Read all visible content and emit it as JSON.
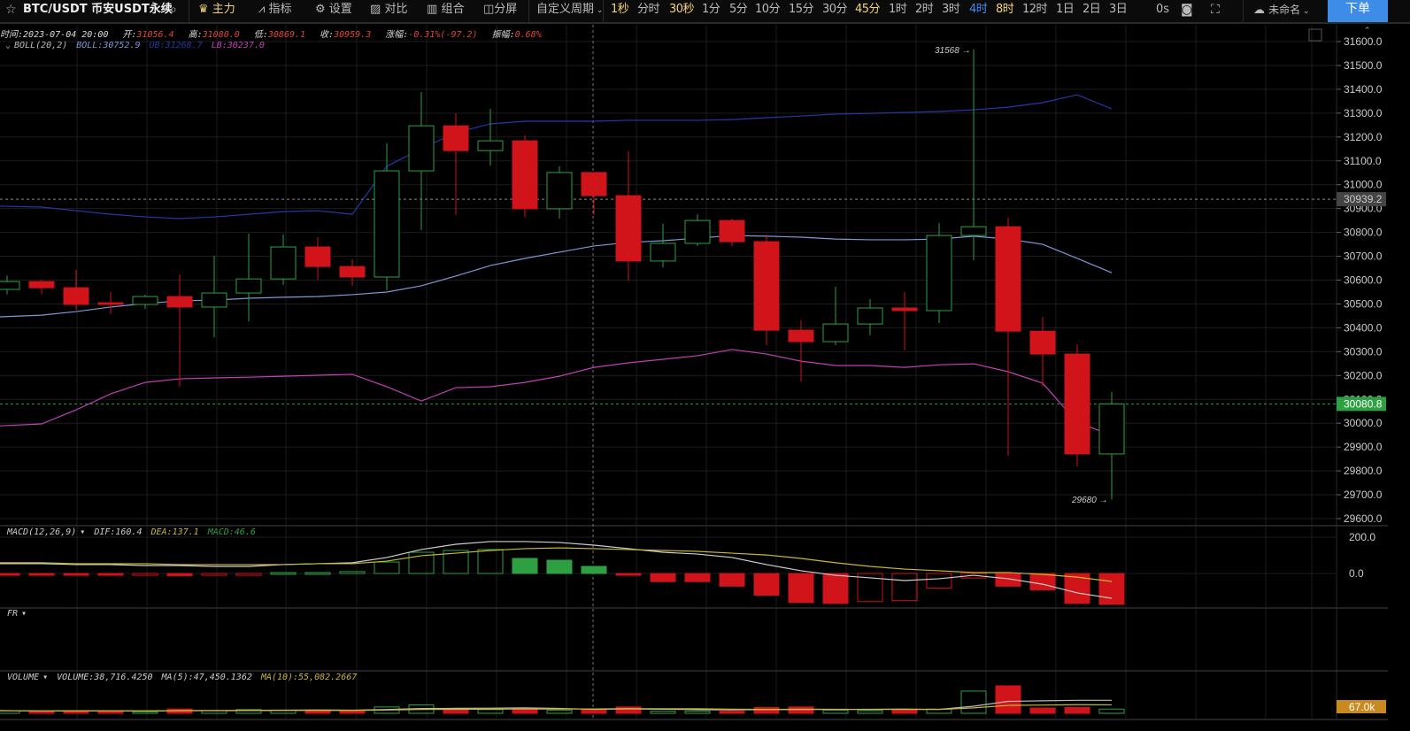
{
  "toolbar": {
    "symbol": "BTC/USDT 币安USDT永续",
    "main": "主力",
    "indicators": "指标",
    "settings": "设置",
    "compare": "对比",
    "combo": "组合",
    "split": "分屏",
    "custom_period": "自定义周期",
    "periods": [
      "1秒",
      "分时",
      "30秒",
      "1分",
      "5分",
      "10分",
      "15分",
      "30分",
      "45分",
      "1时",
      "2时",
      "3时",
      "4时",
      "8时",
      "12时",
      "1日",
      "2日",
      "3日"
    ],
    "highlighted_periods": [
      "1秒",
      "30秒",
      "45分",
      "8时"
    ],
    "active_period": "4时",
    "timer": "0s",
    "layout_name": "未命名",
    "order": "下单"
  },
  "info": {
    "time_label": "时间:",
    "time": "2023-07-04 20:00",
    "open_label": "开:",
    "open": "31056.4",
    "high_label": "高:",
    "high": "31080.0",
    "low_label": "低:",
    "low": "30869.1",
    "close_label": "收:",
    "close": "30959.3",
    "change_label": "涨幅:",
    "change": "-0.31%(-97.2)",
    "amp_label": "振幅:",
    "amp": "0.68%"
  },
  "boll_legend": {
    "name": "BOLL(20,2)",
    "boll": "BOLL:30752.9",
    "ub": "UB:31268.7",
    "lb": "LB:30237.0"
  },
  "macd_legend": {
    "name": "MACD(12,26,9)",
    "dif": "DIF:160.4",
    "dea": "DEA:137.1",
    "macd": "MACD:46.6"
  },
  "fr_legend": {
    "name": "FR"
  },
  "volume_legend": {
    "name": "VOLUME",
    "volume": "VOLUME:38,716.4250",
    "ma5": "MA(5):47,450.1362",
    "ma10": "MA(10):55,082.2667"
  },
  "price_axis": [
    "31600.0",
    "31500.0",
    "31400.0",
    "31300.0",
    "31200.0",
    "31100.0",
    "31000.0",
    "30900.0",
    "30800.0",
    "30700.0",
    "30600.0",
    "30500.0",
    "30400.0",
    "30300.0",
    "30200.0",
    "30100.0",
    "30000.0",
    "29900.0",
    "29800.0",
    "29700.0",
    "29600.0"
  ],
  "macd_axis": [
    "200.0",
    "0.0"
  ],
  "crosshair_price": "30939.2",
  "last_price": "30080.8",
  "volume_marker": "67.0k",
  "max_label": "31568 →",
  "min_label": "29680 →",
  "colors": {
    "up": "#2ea043",
    "down": "#d0141a",
    "boll": "#7d97d8",
    "ub": "#2638a8",
    "lb": "#c23fb8",
    "dif": "#cfcfcf",
    "dea": "#c9b832",
    "accent": "#3d8ce8"
  },
  "chart_data": {
    "type": "candlestick",
    "open": [
      30561,
      30594,
      30568,
      30505,
      30498,
      30531,
      30487,
      30546,
      30605,
      30739,
      30657,
      30613,
      31058,
      31247,
      31143,
      31184,
      30899,
      31051,
      30954,
      30680,
      30754,
      30850,
      30761,
      30390,
      30342,
      30416,
      30483,
      30472,
      30787,
      30824,
      30386,
      30290,
      29871
    ],
    "close": [
      30594,
      30568,
      30498,
      30498,
      30531,
      30487,
      30546,
      30605,
      30739,
      30657,
      30613,
      31058,
      31247,
      31143,
      31184,
      30899,
      31051,
      30954,
      30680,
      30754,
      30850,
      30761,
      30390,
      30342,
      30416,
      30483,
      30472,
      30787,
      30824,
      30386,
      30290,
      29871,
      30081
    ],
    "high": [
      30620,
      30602,
      30643,
      30550,
      30539,
      30624,
      30702,
      30795,
      30791,
      30780,
      30687,
      31173,
      31388,
      31299,
      31318,
      31207,
      31077,
      31051,
      31140,
      30836,
      30876,
      30858,
      30791,
      30431,
      30572,
      30520,
      30550,
      30839,
      31568,
      30861,
      30446,
      30331,
      30131
    ],
    "low": [
      30540,
      30540,
      30476,
      30457,
      30479,
      30153,
      30360,
      30427,
      30579,
      30602,
      30576,
      30557,
      30810,
      30873,
      31080,
      30865,
      30858,
      30873,
      30598,
      30654,
      30743,
      30743,
      30327,
      30175,
      30327,
      30368,
      30305,
      30420,
      30683,
      29863,
      30153,
      29819,
      29680
    ],
    "boll": [
      30446,
      30453,
      30468,
      30487,
      30502,
      30513,
      30516,
      30524,
      30528,
      30531,
      30539,
      30550,
      30576,
      30617,
      30661,
      30691,
      30717,
      30743,
      30758,
      30765,
      30776,
      30787,
      30784,
      30780,
      30772,
      30769,
      30769,
      30772,
      30784,
      30772,
      30750,
      30691,
      30631
    ],
    "ub": [
      30910,
      30906,
      30891,
      30876,
      30865,
      30858,
      30865,
      30876,
      30887,
      30891,
      30876,
      31077,
      31151,
      31218,
      31255,
      31266,
      31266,
      31266,
      31270,
      31270,
      31270,
      31273,
      31281,
      31288,
      31296,
      31299,
      31303,
      31307,
      31314,
      31325,
      31344,
      31377,
      31318
    ],
    "lb": [
      29989,
      29997,
      30056,
      30123,
      30171,
      30186,
      30190,
      30193,
      30197,
      30201,
      30205,
      30153,
      30093,
      30149,
      30153,
      30171,
      30197,
      30234,
      30253,
      30268,
      30283,
      30309,
      30290,
      30260,
      30242,
      30242,
      30234,
      30245,
      30249,
      30216,
      30168,
      30004,
      29949
    ],
    "macd": [
      -3,
      -4,
      -6,
      -8,
      -6,
      -12,
      -8,
      -4,
      5,
      5,
      10,
      63,
      117,
      127,
      132,
      83,
      73,
      39,
      -5,
      -45,
      -45,
      -70,
      -120,
      -160,
      -165,
      -155,
      -150,
      -80,
      -25,
      -70,
      -90,
      -165,
      -170
    ],
    "dif": [
      54,
      54,
      49,
      49,
      44,
      44,
      39,
      39,
      49,
      54,
      59,
      88,
      132,
      161,
      176,
      176,
      171,
      156,
      137,
      117,
      107,
      88,
      49,
      15,
      -10,
      -24,
      -39,
      -29,
      -10,
      -29,
      -59,
      -107,
      -137
    ],
    "dea": [
      59,
      59,
      54,
      54,
      54,
      49,
      49,
      49,
      49,
      54,
      54,
      68,
      98,
      112,
      127,
      137,
      141,
      137,
      132,
      127,
      122,
      112,
      102,
      83,
      59,
      39,
      24,
      15,
      5,
      5,
      -5,
      -20,
      -44
    ],
    "volume_k": [
      25,
      20,
      25,
      25,
      15,
      40,
      25,
      35,
      30,
      30,
      25,
      60,
      80,
      40,
      35,
      45,
      30,
      40,
      60,
      20,
      20,
      20,
      55,
      60,
      30,
      25,
      30,
      40,
      210,
      260,
      50,
      55,
      40
    ],
    "ylim": [
      29600,
      31600
    ]
  }
}
